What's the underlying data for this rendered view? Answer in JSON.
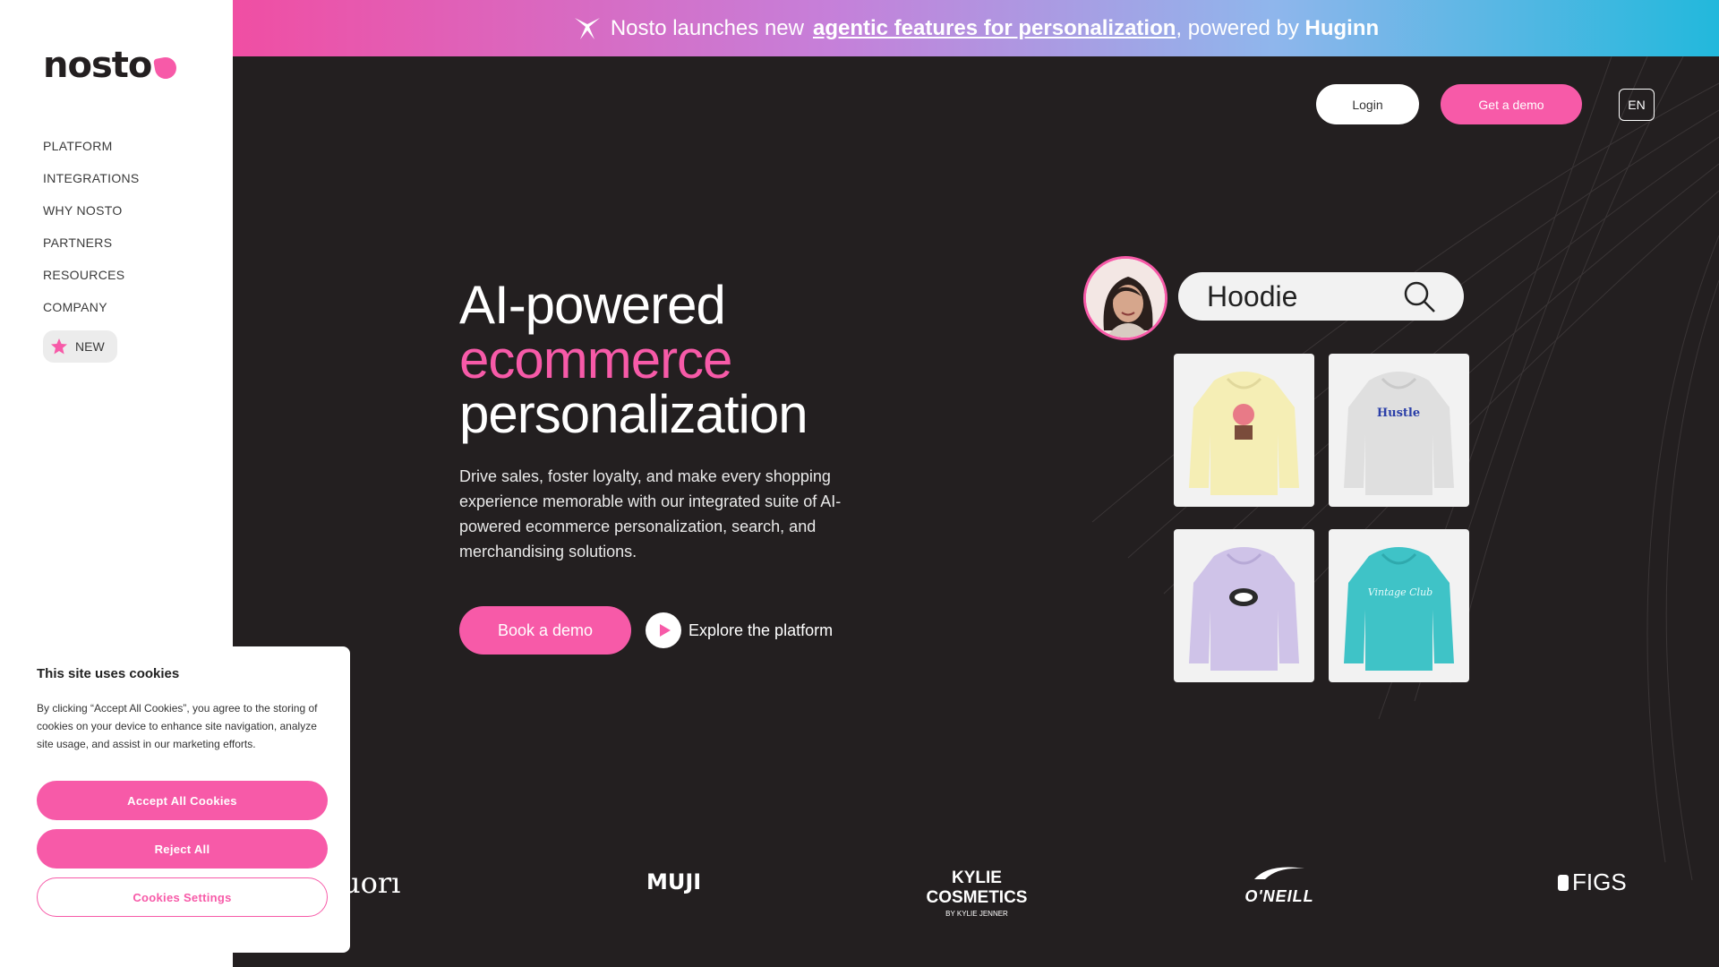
{
  "banner": {
    "prefix": "Nosto launches new",
    "link": "agentic features for personalization",
    "middle": ", powered by",
    "brand": "Huginn"
  },
  "sidebar": {
    "logo": "nosto",
    "items": [
      {
        "label": "PLATFORM"
      },
      {
        "label": "INTEGRATIONS"
      },
      {
        "label": "WHY NOSTO"
      },
      {
        "label": "PARTNERS"
      },
      {
        "label": "RESOURCES"
      },
      {
        "label": "COMPANY"
      }
    ],
    "new_label": "NEW"
  },
  "header": {
    "login": "Login",
    "get_demo": "Get a demo",
    "lang": "EN"
  },
  "hero": {
    "line1": "AI-powered",
    "line2": "ecommerce",
    "line3": "personalization",
    "description": "Drive sales, foster loyalty, and make every shopping experience memorable with our integrated suite of AI-powered ecommerce personalization, search, and merchandising solutions.",
    "book_demo": "Book a demo",
    "explore": "Explore the platform"
  },
  "search_demo": {
    "query": "Hoodie",
    "products": [
      {
        "color": "#f5eeb5",
        "label": ""
      },
      {
        "color": "#ececec",
        "label": "Hustle"
      },
      {
        "color": "#cfc3e8",
        "label": ""
      },
      {
        "color": "#3fc3c7",
        "label": "Vintage Club"
      }
    ]
  },
  "logos": {
    "brand1": "uorı",
    "brand2": "MUJI",
    "brand3": "KYLIE COSMETICS",
    "brand3_sub": "BY KYLIE JENNER",
    "brand4": "O'NEILL",
    "brand5": "FIGS"
  },
  "cookie": {
    "title": "This site uses cookies",
    "body": "By clicking “Accept All Cookies”, you agree to the storing of cookies on your device to enhance site navigation, analyze site usage, and assist in our marketing efforts.",
    "accept": "Accept All Cookies",
    "reject": "Reject All",
    "settings": "Cookies Settings"
  },
  "colors": {
    "accent": "#f75aa8",
    "background": "#231f20"
  }
}
